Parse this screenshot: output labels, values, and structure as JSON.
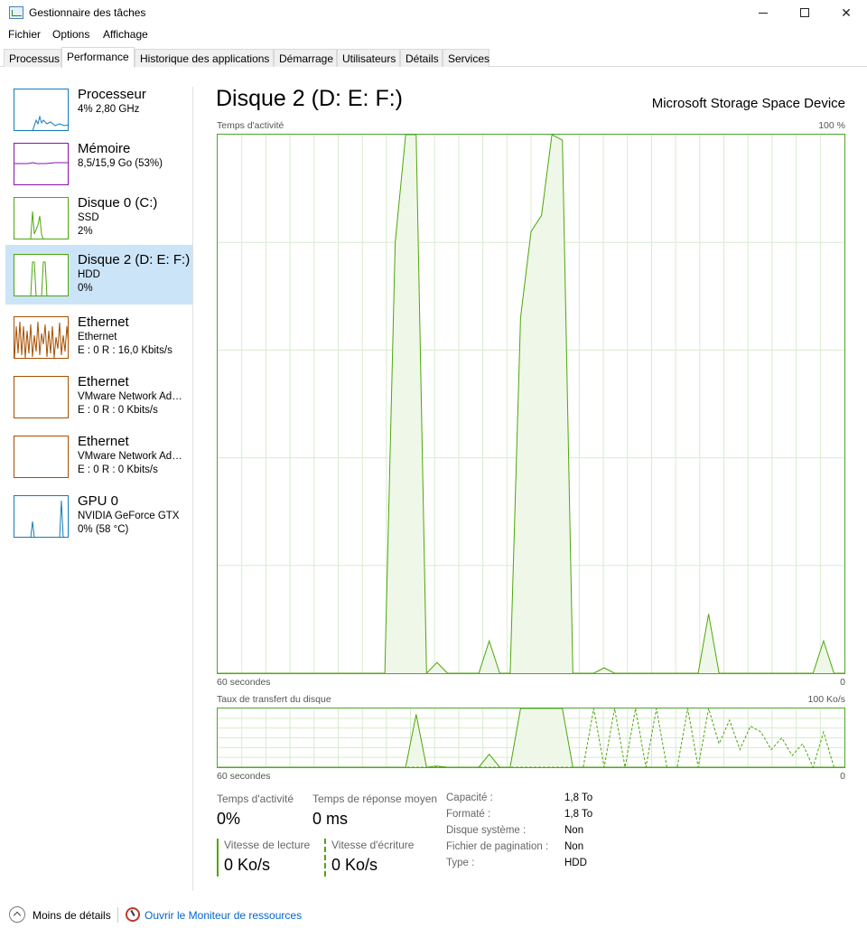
{
  "window": {
    "title": "Gestionnaire des tâches",
    "minimize_glyph": "",
    "close_glyph": "✕"
  },
  "menu": [
    "Fichier",
    "Options",
    "Affichage"
  ],
  "tabs": [
    "Processus",
    "Performance",
    "Historique des applications",
    "Démarrage",
    "Utilisateurs",
    "Détails",
    "Services"
  ],
  "active_tab": "Performance",
  "sidebar": {
    "items": [
      {
        "name": "Processeur",
        "line1": "4%  2,80 GHz",
        "line2": "",
        "color": "#117dbb",
        "selected": false
      },
      {
        "name": "Mémoire",
        "line1": "8,5/15,9 Go (53%)",
        "line2": "",
        "color": "#8b12ae",
        "selected": false
      },
      {
        "name": "Disque 0 (C:)",
        "line1": "SSD",
        "line2": "2%",
        "color": "#4da60c",
        "selected": false
      },
      {
        "name": "Disque 2 (D: E: F:)",
        "line1": "HDD",
        "line2": "0%",
        "color": "#4da60c",
        "selected": true
      },
      {
        "name": "Ethernet",
        "line1": "Ethernet",
        "line2": "E : 0  R : 16,0 Kbits/s",
        "color": "#a74f01",
        "selected": false
      },
      {
        "name": "Ethernet",
        "line1": "VMware Network Adapter VMnet1",
        "line2": "E : 0  R : 0 Kbits/s",
        "color": "#a74f01",
        "selected": false
      },
      {
        "name": "Ethernet",
        "line1": "VMware Network Adapter VMnet8",
        "line2": "E : 0  R : 0 Kbits/s",
        "color": "#a74f01",
        "selected": false
      },
      {
        "name": "GPU 0",
        "line1": "NVIDIA GeForce GTX",
        "line2": "0%  (58 °C)",
        "color": "#117dbb",
        "selected": false
      }
    ]
  },
  "main": {
    "title": "Disque 2 (D: E: F:)",
    "device": "Microsoft Storage Space Device",
    "activity_graph": {
      "label": "Temps d'activité",
      "max_label": "100 %",
      "time_label": "60 secondes",
      "min_label": "0",
      "values_percent": [
        0,
        0,
        0,
        0,
        0,
        0,
        0,
        0,
        0,
        0,
        0,
        0,
        0,
        0,
        0,
        0,
        0,
        80,
        100,
        100,
        0,
        2,
        0,
        0,
        0,
        0,
        6,
        0,
        0,
        66,
        82,
        85,
        100,
        99,
        0,
        0,
        0,
        1,
        0,
        0,
        0,
        0,
        0,
        0,
        0,
        0,
        0,
        11,
        0,
        0,
        0,
        0,
        0,
        0,
        0,
        0,
        0,
        0,
        6,
        0,
        0
      ]
    },
    "transfer_graph": {
      "label": "Taux de transfert du disque",
      "max_label": "100 Ko/s",
      "time_label": "60 secondes",
      "min_label": "0",
      "read_values_percent": [
        0,
        0,
        0,
        0,
        0,
        0,
        0,
        0,
        0,
        0,
        0,
        0,
        0,
        0,
        0,
        0,
        0,
        0,
        0,
        90,
        0,
        2,
        0,
        0,
        0,
        0,
        22,
        0,
        0,
        100,
        100,
        100,
        100,
        100,
        0,
        0,
        0,
        0,
        0,
        0,
        0,
        0,
        0,
        0,
        0,
        0,
        0,
        0,
        0,
        0,
        0,
        0,
        0,
        0,
        0,
        0,
        0,
        0,
        0,
        0,
        0
      ],
      "write_values_percent": [
        0,
        0,
        0,
        0,
        0,
        0,
        0,
        0,
        0,
        0,
        0,
        0,
        0,
        0,
        0,
        0,
        0,
        0,
        0,
        0,
        0,
        0,
        0,
        0,
        0,
        0,
        0,
        0,
        0,
        0,
        0,
        0,
        0,
        0,
        0,
        0,
        100,
        0,
        100,
        0,
        100,
        0,
        100,
        0,
        0,
        100,
        0,
        100,
        40,
        80,
        30,
        70,
        60,
        30,
        50,
        20,
        40,
        0,
        60,
        0,
        0
      ]
    },
    "stats": {
      "activity_label": "Temps d'activité",
      "activity_value": "0%",
      "response_label": "Temps de réponse moyen",
      "response_value": "0 ms",
      "read_label": "Vitesse de lecture",
      "read_value": "0 Ko/s",
      "write_label": "Vitesse d'écriture",
      "write_value": "0 Ko/s"
    },
    "properties": [
      {
        "key": "Capacité :",
        "value": "1,8 To"
      },
      {
        "key": "Formaté :",
        "value": "1,8 To"
      },
      {
        "key": "Disque système :",
        "value": "Non"
      },
      {
        "key": "Fichier de pagination :",
        "value": "Non"
      },
      {
        "key": "Type :",
        "value": "HDD"
      }
    ]
  },
  "footer": {
    "less_details": "Moins de détails",
    "resource_monitor": "Ouvrir le Moniteur de ressources"
  },
  "colors": {
    "disk_green": "#4da60c",
    "disk_fill": "#eff8e8",
    "grid": "#d8eccd",
    "selected_bg": "#cce4f7",
    "link": "#0066cc"
  }
}
